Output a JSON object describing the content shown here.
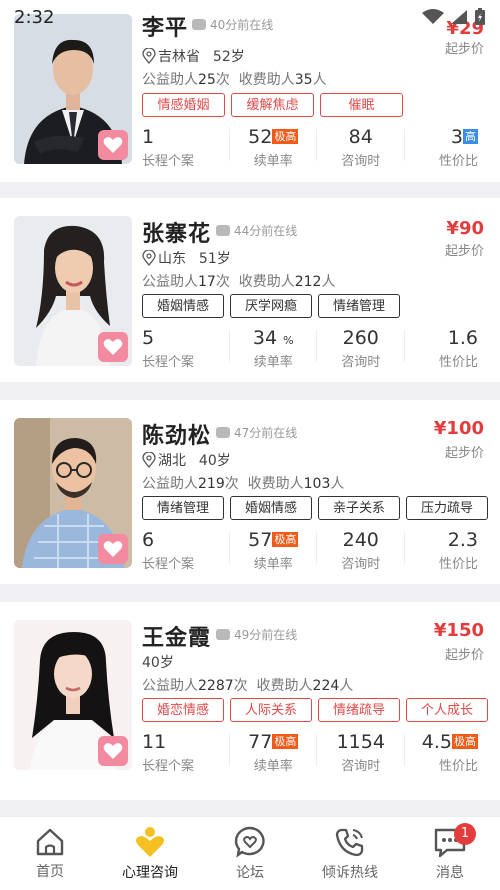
{
  "status": {
    "time": "2:32"
  },
  "colors": {
    "accent": "#e23c3c",
    "tab_active": "#f5c021"
  },
  "counselors": [
    {
      "name": "李平",
      "online": "40分前在线",
      "price": "¥29",
      "price_label": "起步价",
      "location": "吉林省",
      "age": "52岁",
      "public_help_label": "公益助人",
      "public_help": "25",
      "times": "次",
      "paid_help_label": "收费助人",
      "paid_help": "35",
      "persons": "人",
      "tags": [
        "情感婚姻",
        "缓解焦虑",
        "催眠"
      ],
      "tag_style": "red",
      "stats": {
        "cases": "1",
        "renew": "52",
        "renew_badge": "极高",
        "hours": "84",
        "value": "3",
        "value_badge": "高"
      }
    },
    {
      "name": "张寨花",
      "online": "44分前在线",
      "price": "¥90",
      "price_label": "起步价",
      "location": "山东",
      "age": "51岁",
      "public_help_label": "公益助人",
      "public_help": "17",
      "times": "次",
      "paid_help_label": "收费助人",
      "paid_help": "212",
      "persons": "人",
      "tags": [
        "婚姻情感",
        "厌学网瘾",
        "情绪管理"
      ],
      "tag_style": "black",
      "stats": {
        "cases": "5",
        "renew": "34",
        "renew_unit": "%",
        "hours": "260",
        "value": "1.6"
      }
    },
    {
      "name": "陈劲松",
      "online": "47分前在线",
      "price": "¥100",
      "price_label": "起步价",
      "location": "湖北",
      "age": "40岁",
      "public_help_label": "公益助人",
      "public_help": "219",
      "times": "次",
      "paid_help_label": "收费助人",
      "paid_help": "103",
      "persons": "人",
      "tags": [
        "情绪管理",
        "婚姻情感",
        "亲子关系",
        "压力疏导"
      ],
      "tag_style": "black",
      "stats": {
        "cases": "6",
        "renew": "57",
        "renew_badge": "极高",
        "hours": "240",
        "value": "2.3"
      }
    },
    {
      "name": "王金霞",
      "online": "49分前在线",
      "price": "¥150",
      "price_label": "起步价",
      "age": "40岁",
      "public_help_label": "公益助人",
      "public_help": "2287",
      "times": "次",
      "paid_help_label": "收费助人",
      "paid_help": "224",
      "persons": "人",
      "tags": [
        "婚恋情感",
        "人际关系",
        "情绪疏导",
        "个人成长"
      ],
      "tag_style": "red",
      "stats": {
        "cases": "11",
        "renew": "77",
        "renew_badge": "极高",
        "hours": "1154",
        "value": "4.5",
        "value_badge": "极高"
      }
    }
  ],
  "stat_labels": {
    "cases": "长程个案",
    "renew": "续单率",
    "hours": "咨询时",
    "value": "性价比"
  },
  "tabs": [
    {
      "label": "首页",
      "icon": "home-icon"
    },
    {
      "label": "心理咨询",
      "icon": "consult-icon",
      "active": true
    },
    {
      "label": "论坛",
      "icon": "forum-icon"
    },
    {
      "label": "倾诉热线",
      "icon": "hotline-icon"
    },
    {
      "label": "消息",
      "icon": "message-icon",
      "badge": "1"
    }
  ]
}
